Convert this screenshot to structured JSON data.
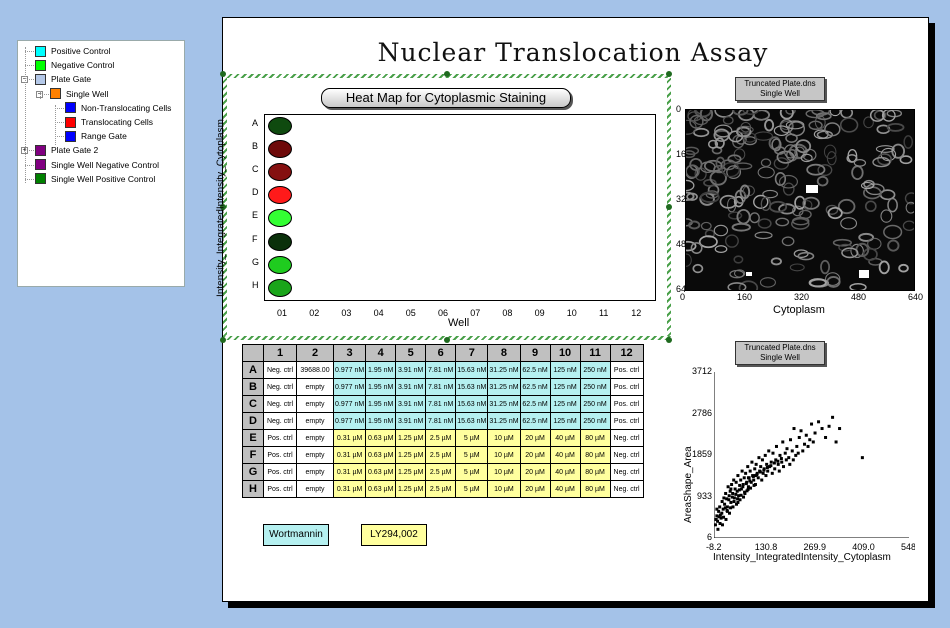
{
  "tree": {
    "items": [
      {
        "label": "Positive Control",
        "color": "#00ffff",
        "indent": 0
      },
      {
        "label": "Negative Control",
        "color": "#00ff00",
        "indent": 0
      },
      {
        "label": "Plate Gate",
        "color": "#b4c8e8",
        "indent": 0,
        "expander": "−"
      },
      {
        "label": "Single Well",
        "color": "#ff8000",
        "indent": 1,
        "expander": "−"
      },
      {
        "label": "Non-Translocating Cells",
        "color": "#0000ff",
        "indent": 2
      },
      {
        "label": "Translocating Cells",
        "color": "#ff0000",
        "indent": 2
      },
      {
        "label": "Range Gate",
        "color": "#0000ff",
        "indent": 2
      },
      {
        "label": "Plate Gate 2",
        "color": "#800080",
        "indent": 0,
        "expander": "+"
      },
      {
        "label": "Single Well Negative Control",
        "color": "#800080",
        "indent": 0
      },
      {
        "label": "Single Well Positive Control",
        "color": "#008000",
        "indent": 0
      }
    ]
  },
  "page": {
    "title": "Nuclear Translocation Assay"
  },
  "heatmap": {
    "title": "Heat Map for Cytoplasmic Staining",
    "ylabel": "Intensity_IntegratedIntensity_Cytoplasm",
    "xlabel": "Well",
    "rows": [
      "A",
      "B",
      "C",
      "D",
      "E",
      "F",
      "G",
      "H"
    ],
    "cols": [
      "01",
      "02",
      "03",
      "04",
      "05",
      "06",
      "07",
      "08",
      "09",
      "10",
      "11",
      "12"
    ],
    "cells": [
      {
        "row": "A",
        "col": "01",
        "color": "#0f4a0f"
      },
      {
        "row": "B",
        "col": "01",
        "color": "#6e0a0a"
      },
      {
        "row": "C",
        "col": "01",
        "color": "#851010"
      },
      {
        "row": "D",
        "col": "01",
        "color": "#ff1a1a"
      },
      {
        "row": "E",
        "col": "01",
        "color": "#33ff33"
      },
      {
        "row": "F",
        "col": "01",
        "color": "#0a300a"
      },
      {
        "row": "G",
        "col": "01",
        "color": "#1fcc1f"
      },
      {
        "row": "H",
        "col": "01",
        "color": "#1aa51a"
      }
    ]
  },
  "image_plot": {
    "title_line1": "Truncated Plate.dns",
    "title_line2": "Single Well",
    "xlabel": "Cytoplasm",
    "xticks": [
      "0",
      "160",
      "320",
      "480",
      "640"
    ],
    "yticks": [
      "0",
      "160",
      "320",
      "480",
      "640"
    ]
  },
  "plate_table": {
    "columns": [
      "1",
      "2",
      "3",
      "4",
      "5",
      "6",
      "7",
      "8",
      "9",
      "10",
      "11",
      "12"
    ],
    "rows": [
      {
        "label": "A",
        "cells": [
          "Neg. ctrl",
          "39688.00",
          "0.977 nM",
          "1.95 nM",
          "3.91 nM",
          "7.81 nM",
          "15.63 nM",
          "31.25 nM",
          "62.5 nM",
          "125 nM",
          "250 nM",
          "Pos. ctrl"
        ]
      },
      {
        "label": "B",
        "cells": [
          "Neg. ctrl",
          "empty",
          "0.977 nM",
          "1.95 nM",
          "3.91 nM",
          "7.81 nM",
          "15.63 nM",
          "31.25 nM",
          "62.5 nM",
          "125 nM",
          "250 nM",
          "Pos. ctrl"
        ]
      },
      {
        "label": "C",
        "cells": [
          "Neg. ctrl",
          "empty",
          "0.977 nM",
          "1.95 nM",
          "3.91 nM",
          "7.81 nM",
          "15.63 nM",
          "31.25 nM",
          "62.5 nM",
          "125 nM",
          "250 nM",
          "Pos. ctrl"
        ]
      },
      {
        "label": "D",
        "cells": [
          "Neg. ctrl",
          "empty",
          "0.977 nM",
          "1.95 nM",
          "3.91 nM",
          "7.81 nM",
          "15.63 nM",
          "31.25 nM",
          "62.5 nM",
          "125 nM",
          "250 nM",
          "Pos. ctrl"
        ]
      },
      {
        "label": "E",
        "cells": [
          "Pos. ctrl",
          "empty",
          "0.31 µM",
          "0.63 µM",
          "1.25 µM",
          "2.5 µM",
          "5 µM",
          "10 µM",
          "20 µM",
          "40 µM",
          "80 µM",
          "Neg. ctrl"
        ]
      },
      {
        "label": "F",
        "cells": [
          "Pos. ctrl",
          "empty",
          "0.31 µM",
          "0.63 µM",
          "1.25 µM",
          "2.5 µM",
          "5 µM",
          "10 µM",
          "20 µM",
          "40 µM",
          "80 µM",
          "Neg. ctrl"
        ]
      },
      {
        "label": "G",
        "cells": [
          "Pos. ctrl",
          "empty",
          "0.31 µM",
          "0.63 µM",
          "1.25 µM",
          "2.5 µM",
          "5 µM",
          "10 µM",
          "20 µM",
          "40 µM",
          "80 µM",
          "Neg. ctrl"
        ]
      },
      {
        "label": "H",
        "cells": [
          "Pos. ctrl",
          "empty",
          "0.31 µM",
          "0.63 µM",
          "1.25 µM",
          "2.5 µM",
          "5 µM",
          "10 µM",
          "20 µM",
          "40 µM",
          "80 µM",
          "Neg. ctrl"
        ]
      }
    ],
    "legend": {
      "wortmannin": "Wortmannin",
      "ly": "LY294,002",
      "wortmannin_color": "#b5f0f0",
      "ly_color": "#ffff9e"
    }
  },
  "chart_data": {
    "type": "scatter",
    "title_line1": "Truncated Plate.dns",
    "title_line2": "Single Well",
    "xlabel": "Intensity_IntegratedIntensity_Cytoplasm",
    "ylabel": "AreaShape_Area",
    "xticks": [
      "-8.2",
      "130.8",
      "269.9",
      "409.0",
      "548.0"
    ],
    "yticks": [
      "6",
      "933",
      "1859",
      "2786",
      "3712"
    ],
    "xlim": [
      -8.2,
      548.0
    ],
    "ylim": [
      6,
      3712
    ],
    "points": [
      [
        -4,
        300
      ],
      [
        -2,
        420
      ],
      [
        0,
        500
      ],
      [
        2,
        380
      ],
      [
        5,
        600
      ],
      [
        8,
        700
      ],
      [
        10,
        520
      ],
      [
        12,
        450
      ],
      [
        15,
        820
      ],
      [
        18,
        650
      ],
      [
        20,
        900
      ],
      [
        22,
        760
      ],
      [
        25,
        1000
      ],
      [
        28,
        880
      ],
      [
        30,
        700
      ],
      [
        32,
        1150
      ],
      [
        35,
        950
      ],
      [
        38,
        1050
      ],
      [
        40,
        800
      ],
      [
        42,
        1200
      ],
      [
        45,
        1000
      ],
      [
        48,
        1300
      ],
      [
        50,
        900
      ],
      [
        52,
        1100
      ],
      [
        55,
        1250
      ],
      [
        58,
        1050
      ],
      [
        60,
        1400
      ],
      [
        62,
        950
      ],
      [
        65,
        1180
      ],
      [
        68,
        1300
      ],
      [
        70,
        1100
      ],
      [
        72,
        1500
      ],
      [
        75,
        1200
      ],
      [
        78,
        1350
      ],
      [
        80,
        1000
      ],
      [
        82,
        1450
      ],
      [
        85,
        1250
      ],
      [
        88,
        1600
      ],
      [
        90,
        1150
      ],
      [
        92,
        1350
      ],
      [
        95,
        1500
      ],
      [
        98,
        1250
      ],
      [
        100,
        1700
      ],
      [
        102,
        1400
      ],
      [
        105,
        1300
      ],
      [
        108,
        1550
      ],
      [
        110,
        1200
      ],
      [
        112,
        1650
      ],
      [
        115,
        1450
      ],
      [
        118,
        1350
      ],
      [
        120,
        1800
      ],
      [
        122,
        1500
      ],
      [
        125,
        1600
      ],
      [
        128,
        1300
      ],
      [
        130,
        1750
      ],
      [
        132,
        1450
      ],
      [
        135,
        1550
      ],
      [
        138,
        1850
      ],
      [
        140,
        1400
      ],
      [
        142,
        1650
      ],
      [
        145,
        1500
      ],
      [
        148,
        1950
      ],
      [
        150,
        1600
      ],
      [
        155,
        1700
      ],
      [
        158,
        1450
      ],
      [
        160,
        1900
      ],
      [
        165,
        1550
      ],
      [
        168,
        1750
      ],
      [
        170,
        2050
      ],
      [
        175,
        1650
      ],
      [
        178,
        1500
      ],
      [
        180,
        1850
      ],
      [
        185,
        1700
      ],
      [
        188,
        2150
      ],
      [
        190,
        1600
      ],
      [
        195,
        1900
      ],
      [
        198,
        1750
      ],
      [
        200,
        2000
      ],
      [
        205,
        1800
      ],
      [
        208,
        1650
      ],
      [
        210,
        2200
      ],
      [
        215,
        1950
      ],
      [
        218,
        1750
      ],
      [
        220,
        2450
      ],
      [
        225,
        1850
      ],
      [
        228,
        2050
      ],
      [
        232,
        1900
      ],
      [
        235,
        2250
      ],
      [
        240,
        2400
      ],
      [
        245,
        1950
      ],
      [
        250,
        2100
      ],
      [
        255,
        2300
      ],
      [
        260,
        2050
      ],
      [
        265,
        2200
      ],
      [
        270,
        2550
      ],
      [
        275,
        2150
      ],
      [
        280,
        2350
      ],
      [
        290,
        2600
      ],
      [
        300,
        2450
      ],
      [
        310,
        2250
      ],
      [
        320,
        2500
      ],
      [
        330,
        2700
      ],
      [
        340,
        2150
      ],
      [
        350,
        2450
      ],
      [
        415,
        1800
      ],
      [
        30,
        600
      ],
      [
        40,
        1100
      ],
      [
        60,
        800
      ],
      [
        90,
        1350
      ],
      [
        110,
        1400
      ],
      [
        0,
        650
      ],
      [
        6,
        480
      ],
      [
        14,
        560
      ],
      [
        24,
        680
      ],
      [
        34,
        860
      ],
      [
        44,
        920
      ],
      [
        54,
        980
      ],
      [
        64,
        1080
      ],
      [
        74,
        1150
      ],
      [
        84,
        1220
      ],
      [
        94,
        1280
      ],
      [
        104,
        1380
      ],
      [
        114,
        1420
      ],
      [
        124,
        1480
      ],
      [
        134,
        1520
      ],
      [
        144,
        1580
      ],
      [
        154,
        1620
      ],
      [
        164,
        1680
      ],
      [
        174,
        1720
      ],
      [
        184,
        1780
      ],
      [
        16,
        300
      ],
      [
        26,
        420
      ],
      [
        36,
        560
      ],
      [
        46,
        700
      ],
      [
        56,
        760
      ],
      [
        66,
        860
      ],
      [
        76,
        920
      ],
      [
        86,
        1060
      ],
      [
        96,
        1120
      ],
      [
        106,
        1180
      ],
      [
        3,
        200
      ],
      [
        9,
        330
      ],
      [
        19,
        470
      ],
      [
        29,
        620
      ],
      [
        39,
        680
      ],
      [
        49,
        820
      ],
      [
        59,
        880
      ],
      [
        69,
        960
      ],
      [
        79,
        1030
      ],
      [
        89,
        1090
      ]
    ]
  }
}
